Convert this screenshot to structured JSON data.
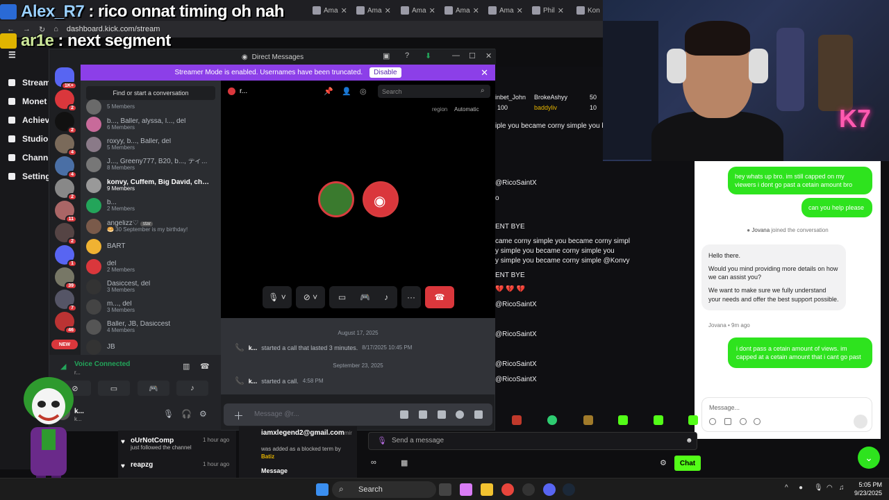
{
  "browser": {
    "url": "dashboard.kick.com/stream",
    "tabs": [
      "Ama",
      "Ama",
      "Ama",
      "Ama",
      "Ama",
      "Phil",
      "Kon"
    ]
  },
  "overlay": {
    "line1_name": "Alex_R7",
    "line1_text": ": rico onnat timing oh nah",
    "line2_name": "ar1e",
    "line2_text": ": next segment"
  },
  "kick_nav": {
    "items": [
      "Stream",
      "Monet",
      "Achiev",
      "Studio",
      "Chann",
      "Setting"
    ]
  },
  "discord": {
    "title": "Direct Messages",
    "banner_text": "Streamer Mode is enabled. Usernames have been truncated.",
    "banner_button": "Disable",
    "find_placeholder": "Find or start a conversation",
    "servers": [
      {
        "count": "1K+"
      },
      {
        "count": "2"
      },
      {
        "count": "2"
      },
      {
        "count": "4"
      },
      {
        "count": "4"
      },
      {
        "count": "2"
      },
      {
        "count": "11"
      },
      {
        "count": "2"
      },
      {
        "count": "1"
      },
      {
        "count": "39"
      },
      {
        "count": "7"
      },
      {
        "count": "46"
      }
    ],
    "new_label": "NEW",
    "dms": [
      {
        "name": "",
        "sub": "5 Members"
      },
      {
        "name": "b..., Baller, alyssa, l..., del",
        "sub": "6 Members"
      },
      {
        "name": "roxyy, b..., Baller, del",
        "sub": "5 Members"
      },
      {
        "name": "J..., Greeny777, B20, b..., ディ...",
        "sub": "8 Members"
      },
      {
        "name": "konvy, Cuffem, Big David, che...",
        "sub": "9 Members"
      },
      {
        "name": "b...",
        "sub": "2 Members"
      },
      {
        "name": "angelizz♡",
        "sub": "🥯 30 September is my birthday!",
        "tag": "star"
      },
      {
        "name": "BART",
        "sub": ""
      },
      {
        "name": "del",
        "sub": "2 Members"
      },
      {
        "name": "Dasiccest, del",
        "sub": "3 Members"
      },
      {
        "name": "m..., del",
        "sub": "3 Members"
      },
      {
        "name": "Baller, JB, Dasiccest",
        "sub": "4 Members"
      },
      {
        "name": "JB",
        "sub": ""
      }
    ],
    "voice": {
      "status": "Voice Connected",
      "channel": "r..."
    },
    "user": {
      "name": "k...",
      "sub": "k..."
    },
    "call": {
      "header": "r...",
      "search_placeholder": "Search",
      "region_label": "region",
      "region_value": "Automatic"
    },
    "messages": [
      {
        "date": "August 17, 2025",
        "user": "k...",
        "text": "started a call that lasted 3 minutes.",
        "time": "8/17/2025 10:45 PM"
      },
      {
        "date": "September 23, 2025",
        "user": "k...",
        "text": "started a call.",
        "time": "4:58 PM"
      }
    ],
    "input_placeholder": "Message @r..."
  },
  "kick_chat": {
    "leaderboard": [
      {
        "name": "BrokeAshyy",
        "value": "50"
      },
      {
        "name": "baddyliv",
        "value": "10"
      }
    ],
    "left_name": "inbet_John",
    "left_value": "100",
    "lines": [
      "iple you became corny simple you bec",
      "@RicoSaintX",
      "o",
      "ENT BYE",
      "came corny simple you became corny simpl",
      "y simple you became corny simple you",
      "y simple you became corny simple @Konvy",
      "ENT BYE",
      "💔 💔 💔",
      "@RicoSaintX",
      "@RicoSaintX",
      "@RicoSaintX",
      "@RicoSaintX"
    ]
  },
  "support": {
    "out1": "hey whats up bro. im still capped on my viewers i dont go past a cetain amount bro",
    "out2": "can you help please",
    "joined_name": "Jovana",
    "joined_text": "joined the conversation",
    "in_p1": "Hello there.",
    "in_p2": "Would you mind providing more details on how we can assist you?",
    "in_p3": "We want to make sure we fully understand your needs and offer the best support possible.",
    "meta": "Jovana • 9m ago",
    "out3": "i dont pass a cetain amount of views. im capped at a cetain amount that i cant go past",
    "input_placeholder": "Message..."
  },
  "activity": [
    {
      "name": "oUrNotComp",
      "sub": "just followed the channel",
      "time": "1 hour ago"
    },
    {
      "name": "reapzg",
      "sub": "",
      "time": "1 hour ago"
    }
  ],
  "blocked": {
    "email": "iamxlegend2@gmail.com",
    "suffix": "mir",
    "line1": "was added as a blocked term by",
    "by": "Batiz",
    "line2": "Message"
  },
  "send_placeholder": "Send a message",
  "chat_button": "Chat",
  "taskbar": {
    "search": "Search",
    "time": "5:05 PM",
    "date": "9/23/2025"
  }
}
